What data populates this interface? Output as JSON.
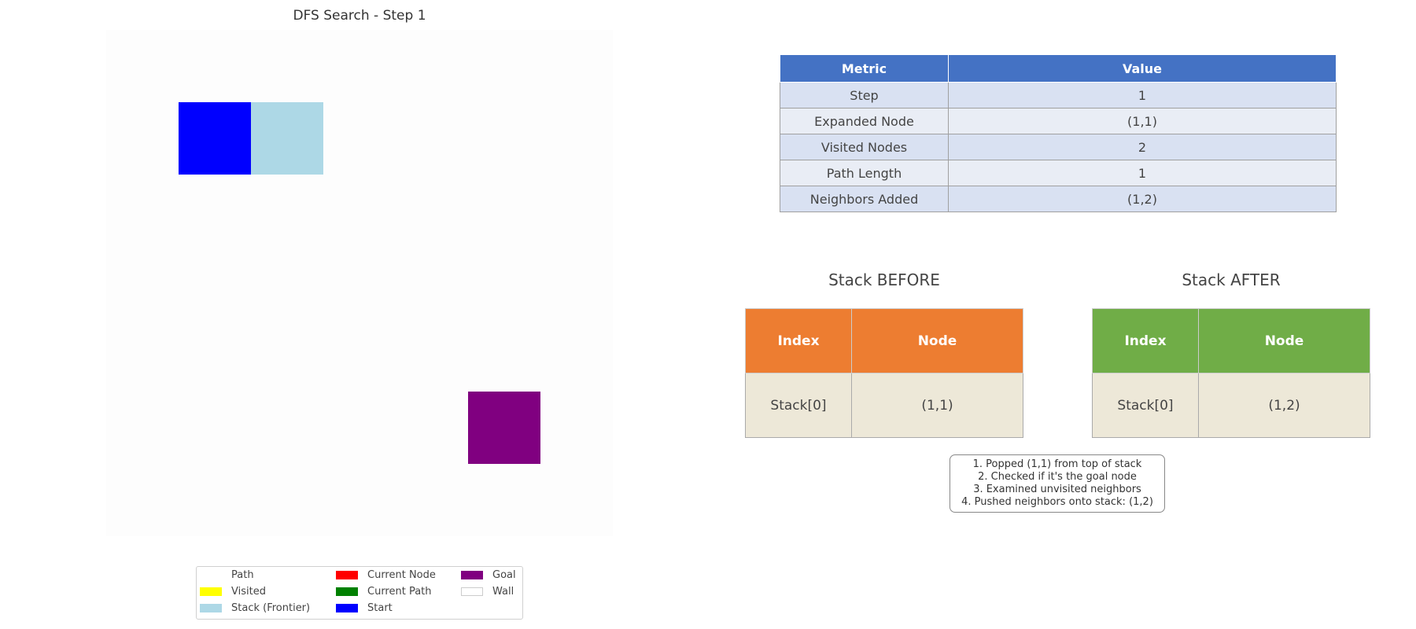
{
  "title": "DFS Search - Step 1",
  "grid": {
    "cells": [
      {
        "row": 1,
        "col": 1,
        "state": "start",
        "color": "#0000ff"
      },
      {
        "row": 1,
        "col": 2,
        "state": "stack",
        "color": "#add8e6"
      },
      {
        "row": 5,
        "col": 5,
        "state": "goal",
        "color": "#800080"
      }
    ]
  },
  "metrics": {
    "headers": [
      "Metric",
      "Value"
    ],
    "rows": [
      [
        "Step",
        "1"
      ],
      [
        "Expanded Node",
        "(1,1)"
      ],
      [
        "Visited Nodes",
        "2"
      ],
      [
        "Path Length",
        "1"
      ],
      [
        "Neighbors Added",
        "(1,2)"
      ]
    ]
  },
  "stack_before": {
    "title": "Stack BEFORE",
    "headers": [
      "Index",
      "Node"
    ],
    "rows": [
      [
        "Stack[0]",
        "(1,1)"
      ]
    ]
  },
  "stack_after": {
    "title": "Stack AFTER",
    "headers": [
      "Index",
      "Node"
    ],
    "rows": [
      [
        "Stack[0]",
        "(1,2)"
      ]
    ]
  },
  "steps": [
    "1. Popped (1,1) from top of stack",
    "2. Checked if it's the goal node",
    "3. Examined unvisited neighbors",
    "4. Pushed neighbors onto stack: (1,2)"
  ],
  "legend": [
    {
      "label": "Path",
      "color": "#ffffff"
    },
    {
      "label": "Visited",
      "color": "#ffff00"
    },
    {
      "label": "Stack (Frontier)",
      "color": "#add8e6"
    },
    {
      "label": "Current Node",
      "color": "#ff0000"
    },
    {
      "label": "Current Path",
      "color": "#008000"
    },
    {
      "label": "Start",
      "color": "#0000ff"
    },
    {
      "label": "Goal",
      "color": "#800080"
    },
    {
      "label": "Wall",
      "color": "#ffffff"
    }
  ]
}
